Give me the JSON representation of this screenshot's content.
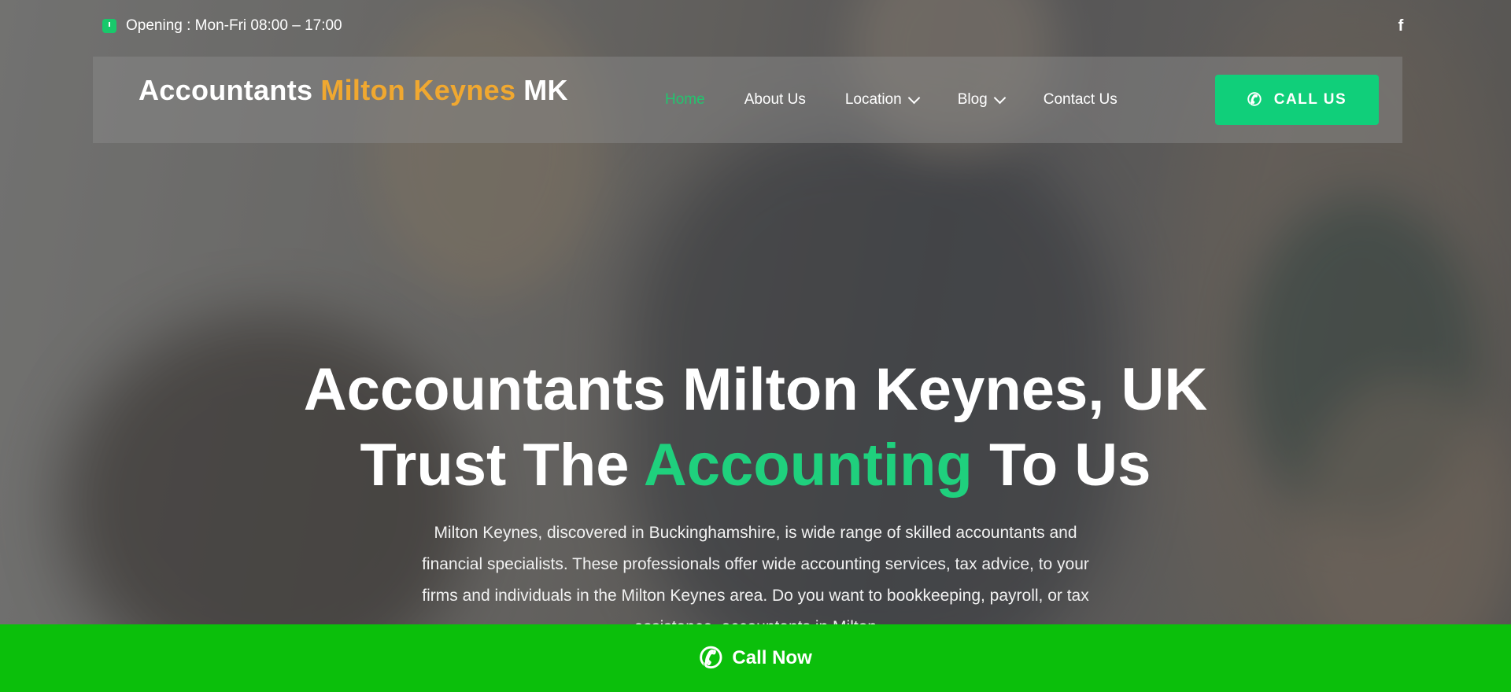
{
  "topbar": {
    "opening_text": "Opening : Mon-Fri 08:00 – 17:00",
    "opening_icon": "clock-icon",
    "social_icon": "facebook-icon",
    "social_glyph": "f"
  },
  "logo": {
    "part1": "Accountants",
    "part2": "Milton Keynes",
    "part3": "MK"
  },
  "nav": {
    "items": [
      {
        "label": "Home",
        "active": true
      },
      {
        "label": "About Us"
      },
      {
        "label": "Location",
        "dropdown": true
      },
      {
        "label": "Blog",
        "dropdown": true
      },
      {
        "label": "Contact Us"
      }
    ],
    "call_label": "CALL US",
    "call_icon": "phone-icon"
  },
  "hero": {
    "line1": "Accountants Milton Keynes, UK",
    "line2_start": "Trust The",
    "line2_highlight": "Accounting",
    "line2_end": "To Us",
    "description": "Milton Keynes, discovered in Buckinghamshire, is wide range of skilled accountants and financial specialists. These professionals offer wide accounting services, tax advice, to your firms and individuals in the Milton Keynes area. Do you want to bookkeeping, payroll, or tax assistance, accountants in Milton"
  },
  "sticky_bar": {
    "label": "Call Now",
    "icon": "phone-icon"
  },
  "colors": {
    "accent_green": "#1fd07d",
    "button_green": "#10cf7a",
    "sticky_green": "#0bbf0b",
    "logo_orange": "#f0a830"
  }
}
